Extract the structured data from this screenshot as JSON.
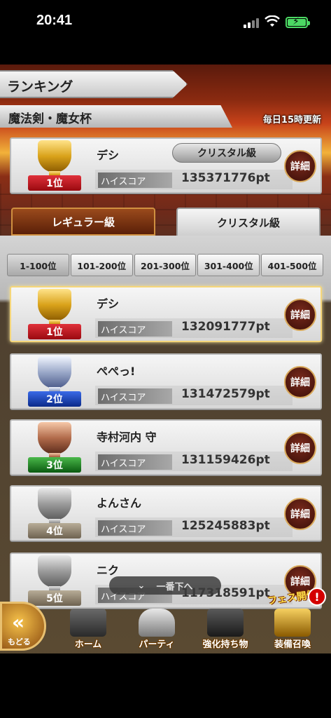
{
  "status": {
    "time": "20:41"
  },
  "header": {
    "title": "ランキング",
    "event": "魔法剣・魔女杯",
    "update": "毎日15時更新"
  },
  "my_rank": {
    "rank": "1位",
    "name": "デシ",
    "class_tag": "クリスタル級",
    "score_label": "ハイスコア",
    "score": "135371776pt",
    "detail": "詳細"
  },
  "tabs": {
    "regular": "レギュラー級",
    "crystal": "クリスタル級",
    "selected": "crystal"
  },
  "ranges": [
    "1-100位",
    "101-200位",
    "201-300位",
    "301-400位",
    "401-500位"
  ],
  "rows": [
    {
      "rank": "1位",
      "name": "デシ",
      "score_label": "ハイスコア",
      "score": "132091777pt",
      "detail": "詳細"
    },
    {
      "rank": "2位",
      "name": "ぺぺっ!",
      "score_label": "ハイスコア",
      "score": "131472579pt",
      "detail": "詳細"
    },
    {
      "rank": "3位",
      "name": "寺村河内 守",
      "score_label": "ハイスコア",
      "score": "131159426pt",
      "detail": "詳細"
    },
    {
      "rank": "4位",
      "name": "よんさん",
      "score_label": "ハイスコア",
      "score": "125245883pt",
      "detail": "詳細"
    },
    {
      "rank": "5位",
      "name": "ニク",
      "score_label": "ハイスコア",
      "score": "117318591pt",
      "detail": "詳細"
    }
  ],
  "scroll_bottom": "一番下へ",
  "nav": {
    "back": "もどる",
    "home": "ホーム",
    "party": "パーティ",
    "items": "強化持ち物",
    "summon": "装備召喚",
    "fes": "フェス開催",
    "badge": "!"
  }
}
